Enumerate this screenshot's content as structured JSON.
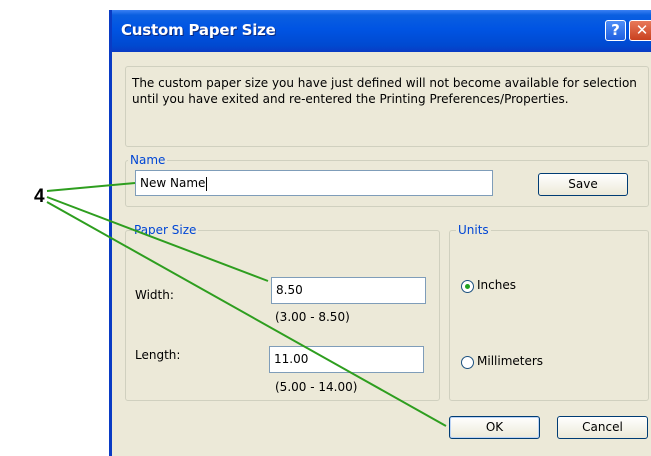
{
  "window": {
    "title": "Custom Paper Size",
    "help_glyph": "?",
    "close_glyph": "✕"
  },
  "notice": {
    "line1": "The custom paper size you have just defined will not become available for selection",
    "line2": "until you have exited and re-entered the Printing Preferences/Properties."
  },
  "name_group": {
    "legend": "Name",
    "value": "New Name",
    "save_label": "Save"
  },
  "paper_size": {
    "legend": "Paper Size",
    "width_label": "Width:",
    "width_value": "8.50",
    "width_range": "(3.00 - 8.50)",
    "length_label": "Length:",
    "length_value": "11.00",
    "length_range": "(5.00 - 14.00)"
  },
  "units": {
    "legend": "Units",
    "inches": "Inches",
    "millimeters": "Millimeters",
    "selected": "Inches"
  },
  "buttons": {
    "ok": "OK",
    "cancel": "Cancel"
  },
  "callout": {
    "number": "4",
    "color": "#2e9e1f"
  },
  "colors": {
    "titlebar": "#0054e3",
    "dialog_bg": "#ece9d8",
    "legend_text": "#0046d5"
  }
}
